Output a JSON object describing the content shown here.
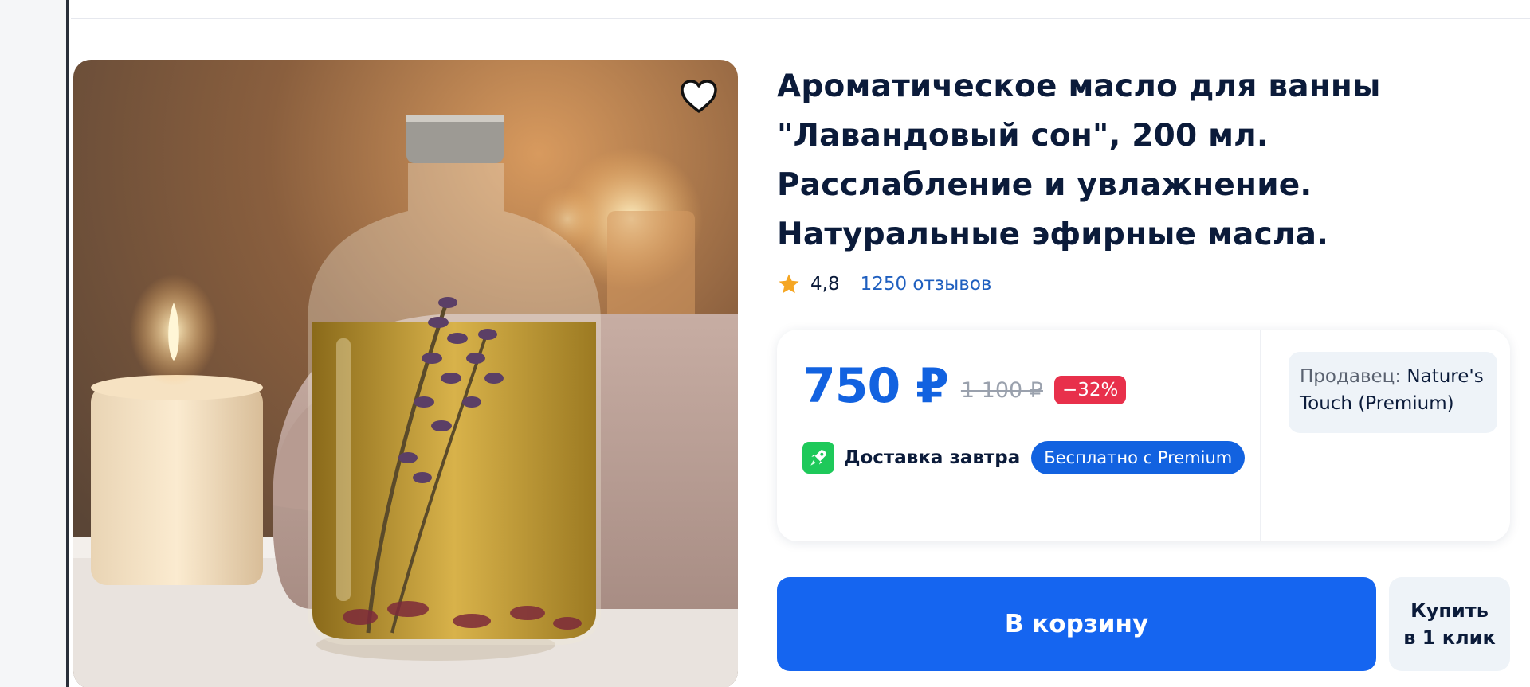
{
  "product": {
    "title": "Ароматическое масло для ванны \"Лавандовый сон\", 200 мл. Расслабление и увлажнение. Натуральные эфирные масла.",
    "image_icon": "lavender-oil-bottle-photo",
    "favorite_icon": "heart-outline-icon"
  },
  "rating": {
    "value": "4,8",
    "reviews": "1250 отзывов",
    "star_icon": "star-icon",
    "star_color": "#f5a623"
  },
  "price": {
    "current": "750 ₽",
    "old": "1 100 ₽",
    "discount": "−32%",
    "accent_color": "#1262e0",
    "discount_color": "#e8304b"
  },
  "delivery": {
    "label": "Доставка завтра",
    "badge": "Бесплатно с Premium",
    "icon": "rocket-icon"
  },
  "seller": {
    "prefix": "Продавец:",
    "name": "Nature's Touch (Premium)"
  },
  "actions": {
    "cart": "В корзину",
    "one_click_line1": "Купить",
    "one_click_line2": "в 1 клик"
  }
}
